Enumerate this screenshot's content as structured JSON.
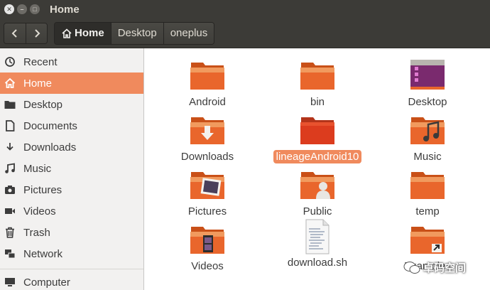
{
  "window": {
    "title": "Home"
  },
  "toolbar": {
    "back_icon": "chevron-left-icon",
    "forward_icon": "chevron-right-icon",
    "breadcrumbs": [
      "Home",
      "Desktop",
      "oneplus"
    ]
  },
  "sidebar": {
    "items": [
      {
        "label": "Recent",
        "icon": "clock-icon"
      },
      {
        "label": "Home",
        "icon": "home-icon",
        "active": true
      },
      {
        "label": "Desktop",
        "icon": "folder-icon"
      },
      {
        "label": "Documents",
        "icon": "document-icon"
      },
      {
        "label": "Downloads",
        "icon": "download-icon"
      },
      {
        "label": "Music",
        "icon": "music-icon"
      },
      {
        "label": "Pictures",
        "icon": "camera-icon"
      },
      {
        "label": "Videos",
        "icon": "film-icon"
      },
      {
        "label": "Trash",
        "icon": "trash-icon"
      },
      {
        "label": "Network",
        "icon": "network-icon"
      },
      {
        "label": "Computer",
        "icon": "computer-icon"
      }
    ]
  },
  "files": [
    {
      "label": "Android",
      "kind": "folder"
    },
    {
      "label": "bin",
      "kind": "folder"
    },
    {
      "label": "Desktop",
      "kind": "desktop-folder"
    },
    {
      "label": "Downloads",
      "kind": "downloads-folder"
    },
    {
      "label": "lineageAndroid10",
      "kind": "folder",
      "selected": true
    },
    {
      "label": "Music",
      "kind": "music-folder"
    },
    {
      "label": "Pictures",
      "kind": "pictures-folder"
    },
    {
      "label": "Public",
      "kind": "public-folder"
    },
    {
      "label": "temp",
      "kind": "folder"
    },
    {
      "label": "Videos",
      "kind": "videos-folder"
    },
    {
      "label": "download.sh",
      "kind": "script-file"
    },
    {
      "label": "Examples",
      "kind": "link-folder"
    }
  ],
  "watermark": {
    "text": "卓码空间"
  },
  "colors": {
    "accent": "#f08a5d",
    "titlebar": "#3c3b37",
    "folder": "#e9662c",
    "sidebar_bg": "#f2f1f0"
  }
}
